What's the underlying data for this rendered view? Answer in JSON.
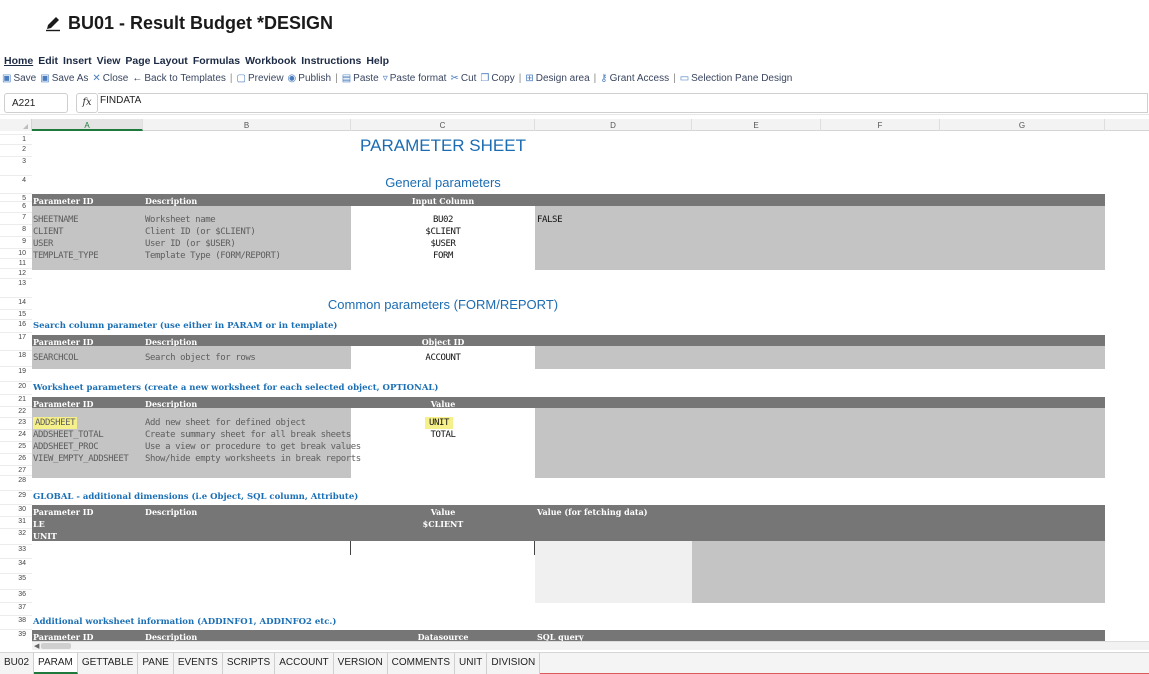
{
  "window": {
    "title": "BU01 - Result Budget *DESIGN",
    "edit_icon": "pencil-icon"
  },
  "menu": {
    "items": [
      "Home",
      "Edit",
      "Insert",
      "View",
      "Page Layout",
      "Formulas",
      "Workbook",
      "Instructions",
      "Help"
    ]
  },
  "toolbar": {
    "save": "Save",
    "save_as": "Save As",
    "close": "Close",
    "back": "Back to Templates",
    "preview": "Preview",
    "publish": "Publish",
    "paste": "Paste",
    "paste_format": "Paste format",
    "cut": "Cut",
    "copy": "Copy",
    "design_area": "Design area",
    "grant_access": "Grant Access",
    "selection_pane": "Selection Pane Design",
    "sep": "|"
  },
  "formula": {
    "cell": "A221",
    "fx": "fx",
    "value": "FINDATA"
  },
  "columns": [
    "A",
    "B",
    "C",
    "D",
    "E",
    "F",
    "G"
  ],
  "rows": [
    "1",
    "2",
    "3",
    "4",
    "5",
    "6",
    "7",
    "8",
    "9",
    "10",
    "11",
    "12",
    "13",
    "14",
    "15",
    "16",
    "17",
    "18",
    "19",
    "20",
    "21",
    "22",
    "23",
    "24",
    "25",
    "26",
    "27",
    "28",
    "29",
    "30",
    "31",
    "32",
    "33",
    "34",
    "35",
    "36",
    "37",
    "38",
    "39"
  ],
  "sheet": {
    "main_title": "PARAMETER SHEET",
    "general": {
      "title": "General parameters",
      "h_param": "Parameter ID",
      "h_desc": "Description",
      "h_input": "Input Column",
      "rows": [
        {
          "id": "SHEETNAME",
          "desc": "Worksheet name",
          "val": "BU02",
          "extra": "FALSE"
        },
        {
          "id": "CLIENT",
          "desc": "Client ID (or $CLIENT)",
          "val": "$CLIENT",
          "extra": ""
        },
        {
          "id": "USER",
          "desc": "User ID (or $USER)",
          "val": "$USER",
          "extra": ""
        },
        {
          "id": "TEMPLATE_TYPE",
          "desc": "Template Type (FORM/REPORT)",
          "val": "FORM",
          "extra": ""
        }
      ]
    },
    "common": {
      "title": "Common parameters (FORM/REPORT)"
    },
    "search": {
      "title": "Search column parameter (use either in PARAM or in template)",
      "h_param": "Parameter ID",
      "h_desc": "Description",
      "h_obj": "Object ID",
      "id": "SEARCHCOL",
      "desc": "Search object for rows",
      "val": "ACCOUNT"
    },
    "worksheet": {
      "title": "Worksheet parameters (create a new worksheet for each selected object, OPTIONAL)",
      "h_param": "Parameter ID",
      "h_desc": "Description",
      "h_value": "Value",
      "rows": [
        {
          "id": "ADDSHEET",
          "desc": "Add new sheet for defined object",
          "val": "UNIT"
        },
        {
          "id": "ADDSHEET_TOTAL",
          "desc": "Create summary sheet for all break sheets",
          "val": "TOTAL"
        },
        {
          "id": "ADDSHEET_PROC",
          "desc": "Use a view or procedure to get break values",
          "val": ""
        },
        {
          "id": "VIEW_EMPTY_ADDSHEET",
          "desc": "Show/hide empty worksheets in break reports",
          "val": ""
        }
      ]
    },
    "global": {
      "title": "GLOBAL - additional dimensions (i.e Object, SQL column, Attribute)",
      "h_param": "Parameter ID",
      "h_desc": "Description",
      "h_value": "Value",
      "h_fetch": "Value (for fetching data)",
      "le": "LE",
      "le_val": "$CLIENT",
      "unit": "UNIT"
    },
    "additional": {
      "title": "Additional worksheet information (ADDINFO1, ADDINFO2 etc.)",
      "h_param": "Parameter ID",
      "h_desc": "Description",
      "h_ds": "Datasource",
      "h_sql": "SQL query"
    }
  },
  "tabs": [
    "BU02",
    "PARAM",
    "GETTABLE",
    "PANE",
    "EVENTS",
    "SCRIPTS",
    "ACCOUNT",
    "VERSION",
    "COMMENTS",
    "UNIT",
    "DIVISION"
  ],
  "active_tab": "PARAM",
  "colors": {
    "accent_green": "#1e7a3c",
    "header_dark": "#767676",
    "cell_gray": "#c4c4c4",
    "title_blue": "#1c6cb2",
    "highlight": "#f6f08a"
  }
}
